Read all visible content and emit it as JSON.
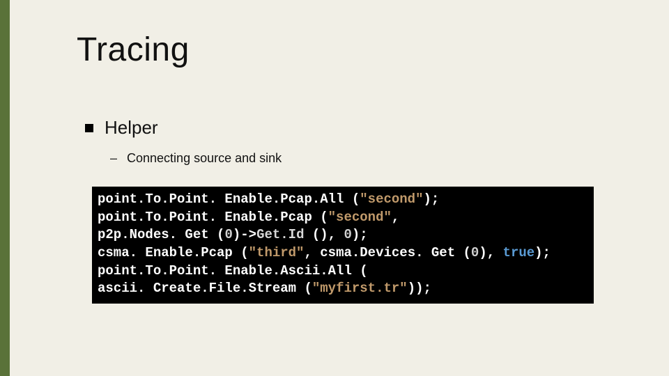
{
  "title": "Tracing",
  "bullet": "Helper",
  "subbullet": "Connecting source and sink",
  "code": {
    "l1": {
      "a": "point.To.Point. Enable.Pcap.All (",
      "s": "\"second\"",
      "b": ");"
    },
    "l2": {
      "a": "point.To.Point. Enable.Pcap (",
      "s": "\"second\"",
      "b": ","
    },
    "l3": {
      "a": "p2p.Nodes. Get (",
      "n1": "0",
      "b": ")->",
      "c": "Get.Id",
      "d": " (), ",
      "n2": "0",
      "e": ");"
    },
    "l4": {
      "a": "csma. Enable.Pcap (",
      "s": "\"third\"",
      "b": ", csma.Devices. Get (",
      "n": "0",
      "c": "), ",
      "kw": "true",
      "d": ");"
    },
    "l5": {
      "a": "point.To.Point. Enable.Ascii.All ("
    },
    "l6": {
      "a": "ascii. Create.File.Stream (",
      "s": "\"myfirst.tr\"",
      "b": "));"
    }
  }
}
